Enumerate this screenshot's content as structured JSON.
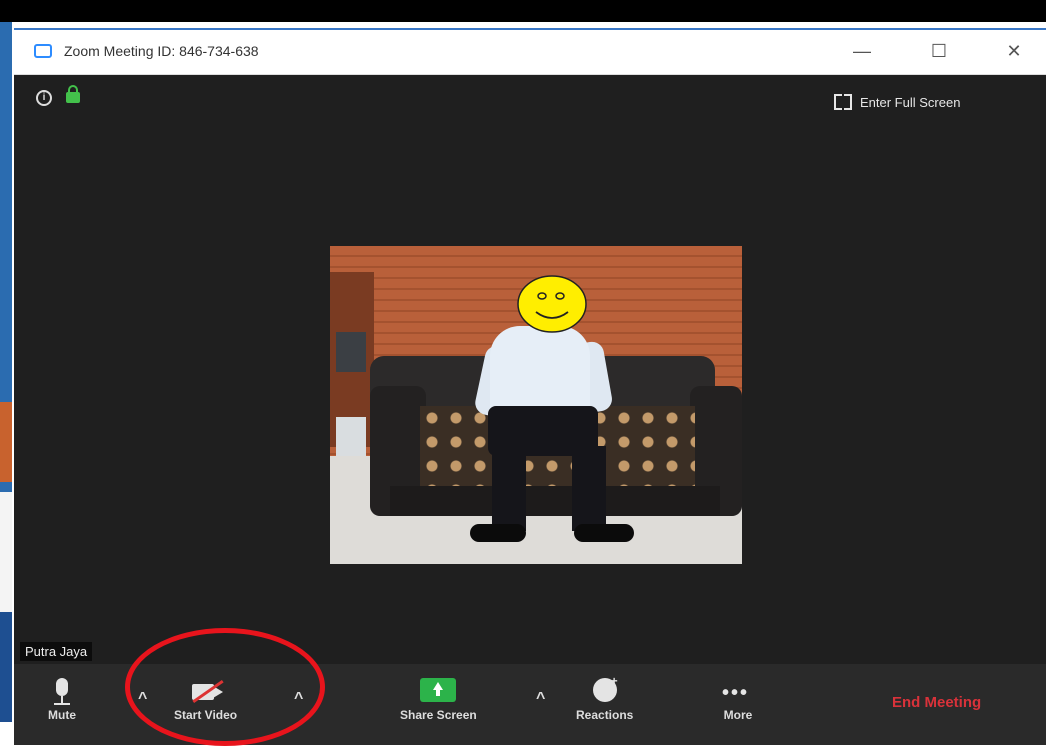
{
  "window": {
    "title": "Zoom Meeting ID: 846-734-638",
    "minimize_glyph": "—",
    "maximize_glyph": "☐",
    "close_glyph": "✕"
  },
  "stage": {
    "fullscreen_label": "Enter Full Screen",
    "participant_name": "Putra Jaya"
  },
  "toolbar": {
    "mute_label": "Mute",
    "start_video_label": "Start Video",
    "share_screen_label": "Share Screen",
    "reactions_label": "Reactions",
    "more_label": "More",
    "more_glyph": "•••",
    "caret_glyph": "^",
    "end_meeting_label": "End Meeting"
  },
  "colors": {
    "accent_green": "#2cb34a",
    "end_meeting_red": "#d9323a",
    "annotation_red": "#e8141c",
    "zoom_blue": "#2d8cff"
  },
  "icons": [
    "info-icon",
    "lock-icon",
    "fullscreen-icon",
    "microphone-icon",
    "video-off-icon",
    "share-screen-icon",
    "reactions-icon",
    "more-icon"
  ]
}
